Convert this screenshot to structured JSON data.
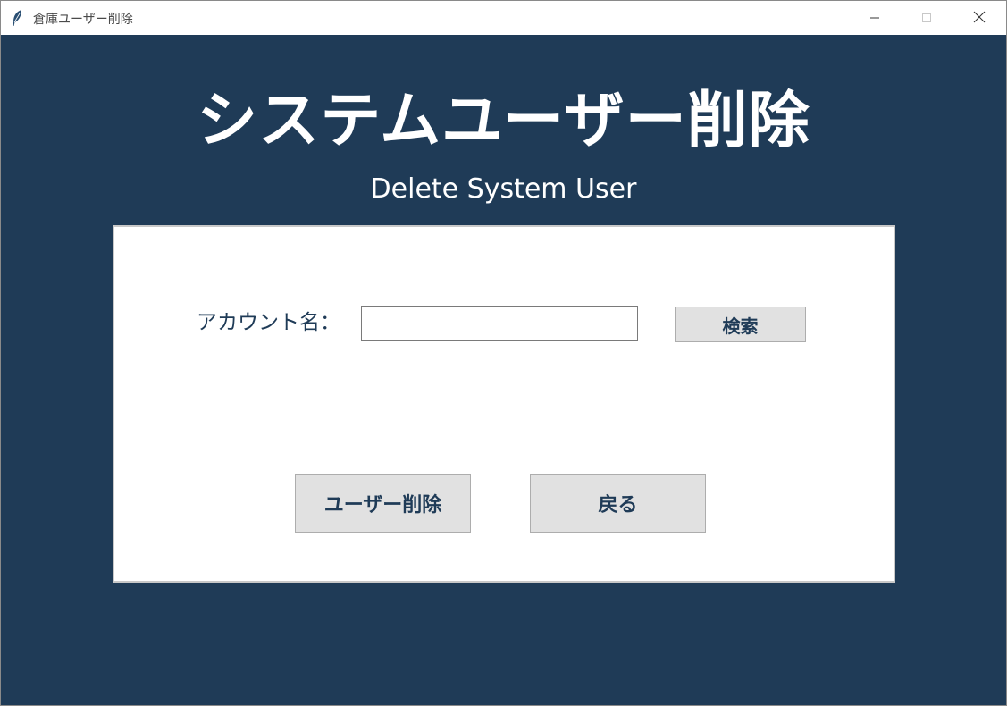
{
  "window": {
    "title": "倉庫ユーザー削除"
  },
  "header": {
    "title": "システムユーザー削除",
    "subtitle": "Delete System User"
  },
  "form": {
    "account_label": "アカウント名：",
    "account_value": "",
    "search_label": "検索",
    "delete_label": "ユーザー削除",
    "back_label": "戻る"
  },
  "colors": {
    "background": "#1f3b57",
    "panel": "#ffffff",
    "button": "#e1e1e1",
    "text_accent": "#1f3b57"
  },
  "icons": {
    "app": "feather-icon",
    "minimize": "minimize-icon",
    "maximize": "maximize-icon",
    "close": "close-icon"
  }
}
